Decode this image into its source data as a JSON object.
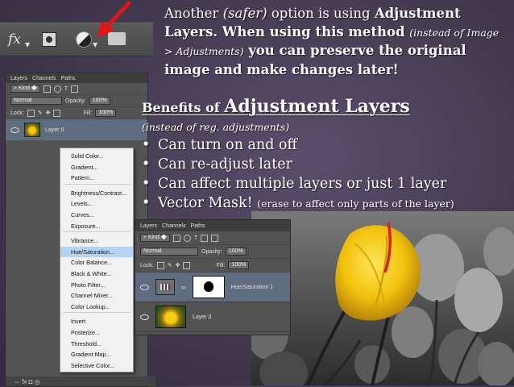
{
  "slide": {
    "intro": {
      "p1": "Another ",
      "p2": "(safer)",
      "p3": " option is using ",
      "p4": "Adjustment Layers. When using this method ",
      "p5": "(instead of Image > Adjustments)",
      "p6": " you can preserve the original image and make changes later!"
    },
    "benefits_title_prefix": "Benefits of ",
    "benefits_title_main": "Adjustment Layers",
    "benefits_subtitle": "(instead of reg. adjustments)",
    "bullets": [
      "Can turn on and off",
      "Can re-adjust later",
      "Can affect multiple layers or just 1 layer",
      "Vector Mask!"
    ],
    "bullet_note": "(erase to affect only parts of the layer)"
  },
  "toolbar": {
    "fx_label": "fx",
    "icons": [
      "fx-icon",
      "layer-mask-icon",
      "adjustment-layer-icon",
      "folder-icon"
    ]
  },
  "left_panel": {
    "tabs": [
      "Layers",
      "Channels",
      "Paths"
    ],
    "filter_label": "Kind",
    "blend_mode": "Normal",
    "opacity_label": "Opacity:",
    "opacity_value": "100%",
    "lock_label": "Lock:",
    "fill_label": "Fill:",
    "fill_value": "100%",
    "layer_name": "Layer 0",
    "bottom_icons": "⇔  fx  ◘  ◎"
  },
  "adjustment_menu": {
    "items": [
      "Solid Color...",
      "Gradient...",
      "Pattern...",
      "Brightness/Contrast...",
      "Levels...",
      "Curves...",
      "Exposure...",
      "Vibrance...",
      "Hue/Saturation...",
      "Color Balance...",
      "Black & White...",
      "Photo Filter...",
      "Channel Mixer...",
      "Color Lookup...",
      "Invert",
      "Posterize...",
      "Threshold...",
      "Gradient Map...",
      "Selective Color..."
    ],
    "highlighted": "Hue/Saturation..."
  },
  "layers_panel": {
    "tabs": [
      "Layers",
      "Channels",
      "Paths"
    ],
    "filter_label": "Kind",
    "blend_mode": "Normal",
    "opacity_label": "Opacity:",
    "opacity_value": "100%",
    "lock_label": "Lock:",
    "fill_label": "Fill:",
    "fill_value": "100%",
    "layers": [
      {
        "name": "Hue/Saturation 1"
      },
      {
        "name": "Layer 0"
      }
    ]
  },
  "colors": {
    "background": "#43394f",
    "arrow": "#e01616",
    "tulip": "#f2c20c",
    "panel": "#535353",
    "selection": "#5f6d80"
  }
}
